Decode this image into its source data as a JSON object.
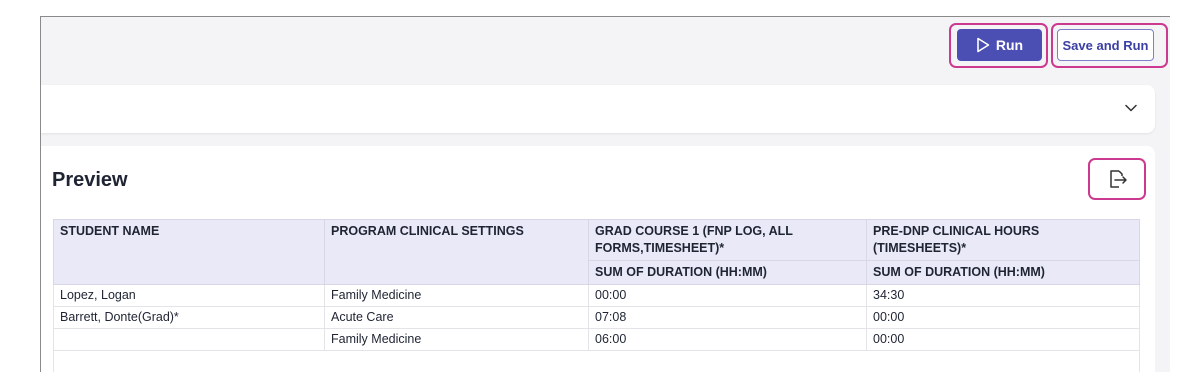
{
  "toolbar": {
    "run_label": "Run",
    "save_and_run_label": "Save and Run",
    "run_icon": "play-icon",
    "colors": {
      "run_bg": "#4b4fb3",
      "highlight": "#cc3a8f"
    }
  },
  "collapse_bar": {
    "icon": "chevron-down-icon"
  },
  "preview": {
    "title": "Preview",
    "export_icon": "export-icon",
    "table": {
      "headers": {
        "student_name": "STUDENT NAME",
        "program_clinical_settings": "PROGRAM CLINICAL SETTINGS",
        "grad_course": "GRAD COURSE 1 (FNP LOG, ALL FORMS,TIMESHEET)*",
        "pre_dnp": "PRE-DNP CLINICAL HOURS (TIMESHEETS)*",
        "grad_course_sub": "SUM OF DURATION (HH:MM)",
        "pre_dnp_sub": "SUM OF DURATION (HH:MM)"
      },
      "rows": [
        {
          "student": "Lopez, Logan",
          "setting": "Family Medicine",
          "grad": "00:00",
          "predn": "34:30"
        },
        {
          "student": "Barrett, Donte(Grad)*",
          "setting": "Acute Care",
          "grad": "07:08",
          "predn": "00:00"
        },
        {
          "student": "",
          "setting": "Family Medicine",
          "grad": "06:00",
          "predn": "00:00"
        }
      ]
    }
  }
}
